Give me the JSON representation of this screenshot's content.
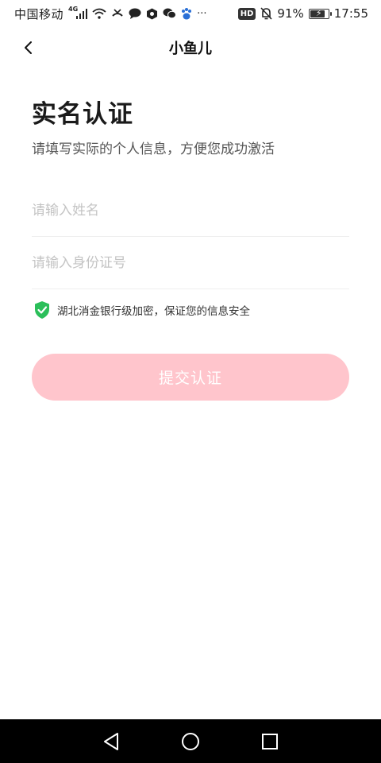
{
  "status_bar": {
    "carrier": "中国移动",
    "network_type": "4G",
    "battery_text": "91%",
    "battery_level_percent": 91,
    "hd_label": "HD",
    "time": "17:55",
    "more": "···",
    "icons": [
      "signal-icon",
      "wifi-icon",
      "missed-call-icon",
      "message-bubble-icon",
      "app-icon",
      "wechat-icon",
      "baidu-paw-icon",
      "mute-bell-icon",
      "battery-icon"
    ]
  },
  "nav": {
    "title": "小鱼儿",
    "back_icon": "chevron-left-icon"
  },
  "hero": {
    "title": "实名认证",
    "subtitle": "请填写实际的个人信息，方便您成功激活"
  },
  "form": {
    "name_placeholder": "请输入姓名",
    "name_value": "",
    "id_placeholder": "请输入身份证号",
    "id_value": ""
  },
  "security": {
    "icon": "shield-check-icon",
    "text": "湖北消金银行级加密，保证您的信息安全"
  },
  "submit": {
    "label": "提交认证"
  },
  "colors": {
    "accent_disabled": "#ffc5cc",
    "shield_green": "#2bbf5a"
  },
  "system_nav": {
    "icons": [
      "nav-back-triangle-icon",
      "nav-home-circle-icon",
      "nav-recents-square-icon"
    ]
  }
}
